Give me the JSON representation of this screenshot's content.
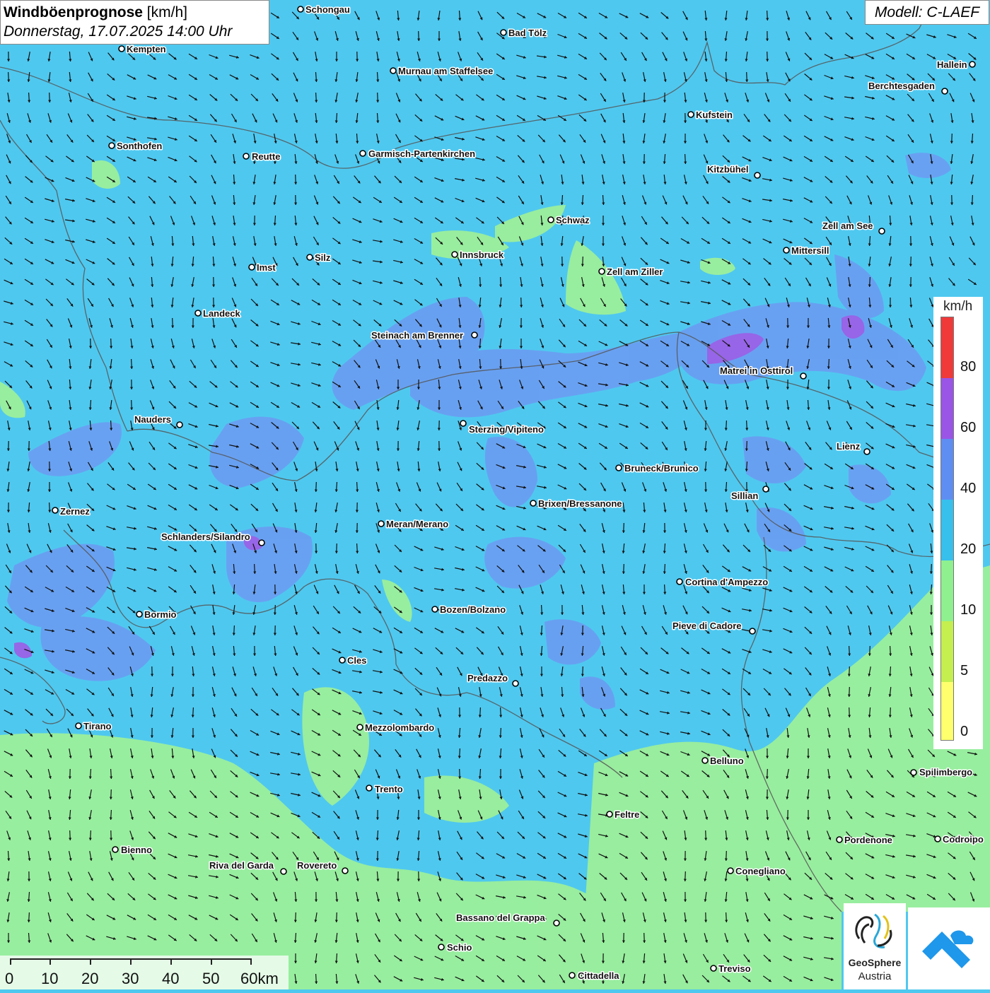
{
  "title": {
    "main_bold": "Windböenprognose",
    "main_unit": " [km/h]",
    "date": "Donnerstag, 17.07.2025 14:00 Uhr"
  },
  "model": "Modell: C-LAEF",
  "legend": {
    "unit": "km/h",
    "ticks": [
      "80",
      "60",
      "40",
      "20",
      "10",
      "5",
      "0"
    ],
    "colors": [
      "#f03a3a",
      "#9a55e6",
      "#5f8ef2",
      "#37c0ec",
      "#8ff08f",
      "#c4ef4f",
      "#ffff6e"
    ]
  },
  "scale_bar": {
    "labels": [
      "0",
      "10",
      "20",
      "30",
      "40",
      "50",
      "60km"
    ]
  },
  "logos": {
    "geosphere_name": "GeoSphere",
    "geosphere_sub": "Austria",
    "icon": "mountain-cloud-icon"
  },
  "colors": {
    "sea_blue": "#4fc8ef",
    "calm_green": "#9cf09a",
    "wind_40": "#6b9cf2",
    "wind_60": "#9a62e6",
    "border": "#555555"
  },
  "cities": [
    {
      "name": "Schongau"
    },
    {
      "name": "Bad Tölz"
    },
    {
      "name": "Kempten"
    },
    {
      "name": "Murnau am Staffelsee"
    },
    {
      "name": "Hallein"
    },
    {
      "name": "Berchtesgaden"
    },
    {
      "name": "Kufstein"
    },
    {
      "name": "Sonthofen"
    },
    {
      "name": "Reutte"
    },
    {
      "name": "Garmisch-Partenkirchen"
    },
    {
      "name": "Kitzbühel"
    },
    {
      "name": "Schwaz"
    },
    {
      "name": "Zell am See"
    },
    {
      "name": "Mittersill"
    },
    {
      "name": "Silz"
    },
    {
      "name": "Innsbruck"
    },
    {
      "name": "Imst"
    },
    {
      "name": "Zell am Ziller"
    },
    {
      "name": "Landeck"
    },
    {
      "name": "Steinach am Brenner"
    },
    {
      "name": "Matrei in Osttirol"
    },
    {
      "name": "Nauders"
    },
    {
      "name": "Sterzing/Vipiteno"
    },
    {
      "name": "Lienz"
    },
    {
      "name": "Bruneck/Brunico"
    },
    {
      "name": "Sillian"
    },
    {
      "name": "Zernez"
    },
    {
      "name": "Brixen/Bressanone"
    },
    {
      "name": "Meran/Merano"
    },
    {
      "name": "Schlanders/Silandro"
    },
    {
      "name": "Cortina d'Ampezzo"
    },
    {
      "name": "Bozen/Bolzano"
    },
    {
      "name": "Bormio"
    },
    {
      "name": "Pieve di Cadore"
    },
    {
      "name": "Cles"
    },
    {
      "name": "Predazzo"
    },
    {
      "name": "Tirano"
    },
    {
      "name": "Mezzolombardo"
    },
    {
      "name": "Belluno"
    },
    {
      "name": "Spilimbergo"
    },
    {
      "name": "Trento"
    },
    {
      "name": "Feltre"
    },
    {
      "name": "Pordenone"
    },
    {
      "name": "Codroipo"
    },
    {
      "name": "Bienno"
    },
    {
      "name": "Riva del Garda"
    },
    {
      "name": "Rovereto"
    },
    {
      "name": "Conegliano"
    },
    {
      "name": "Bassano del Grappa"
    },
    {
      "name": "Schio"
    },
    {
      "name": "Treviso"
    },
    {
      "name": "Cittadella"
    }
  ]
}
